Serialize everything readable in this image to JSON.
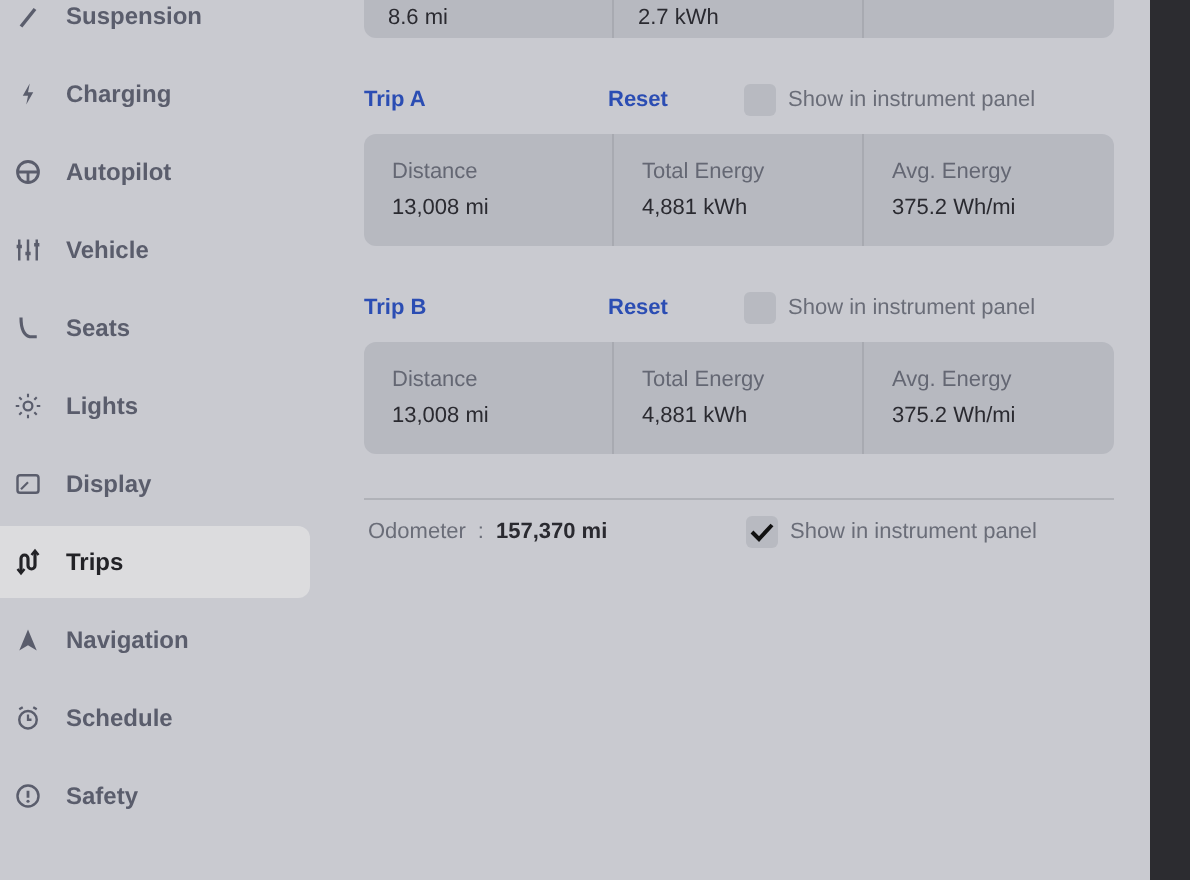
{
  "sidebar": {
    "items": [
      {
        "label": "Suspension",
        "selected": false
      },
      {
        "label": "Charging",
        "selected": false
      },
      {
        "label": "Autopilot",
        "selected": false
      },
      {
        "label": "Vehicle",
        "selected": false
      },
      {
        "label": "Seats",
        "selected": false
      },
      {
        "label": "Lights",
        "selected": false
      },
      {
        "label": "Display",
        "selected": false
      },
      {
        "label": "Trips",
        "selected": true
      },
      {
        "label": "Navigation",
        "selected": false
      },
      {
        "label": "Schedule",
        "selected": false
      },
      {
        "label": "Safety",
        "selected": false
      }
    ]
  },
  "previous_trip": {
    "values": [
      "8.6 mi",
      "2.7 kWh"
    ]
  },
  "trips": [
    {
      "title": "Trip A",
      "reset": "Reset",
      "show_label": "Show in instrument panel",
      "checked": false,
      "stats": [
        {
          "label": "Distance",
          "value": "13,008 mi"
        },
        {
          "label": "Total Energy",
          "value": "4,881 kWh"
        },
        {
          "label": "Avg. Energy",
          "value": "375.2 Wh/mi"
        }
      ]
    },
    {
      "title": "Trip B",
      "reset": "Reset",
      "show_label": "Show in instrument panel",
      "checked": false,
      "stats": [
        {
          "label": "Distance",
          "value": "13,008 mi"
        },
        {
          "label": "Total Energy",
          "value": "4,881 kWh"
        },
        {
          "label": "Avg. Energy",
          "value": "375.2 Wh/mi"
        }
      ]
    }
  ],
  "odometer": {
    "label": "Odometer",
    "separator": ":",
    "value": "157,370 mi",
    "show_label": "Show in instrument panel",
    "checked": true
  }
}
